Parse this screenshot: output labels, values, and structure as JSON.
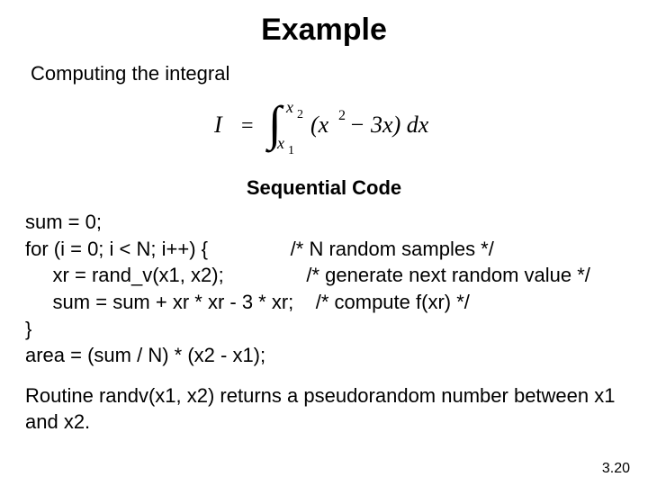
{
  "title": "Example",
  "subtitle": "Computing the integral",
  "integral": {
    "lhs": "I",
    "eq": "=",
    "lower": "x",
    "lower_sub": "1",
    "upper": "x",
    "upper_sub": "2",
    "inner_a": "(x",
    "inner_exp": "2",
    "inner_b": " − 3x) dx"
  },
  "section_heading": "Sequential Code",
  "code": "sum = 0;\nfor (i = 0; i < N; i++) {               /* N random samples */\n     xr = rand_v(x1, x2);               /* generate next random value */\n     sum = sum + xr * xr - 3 * xr;    /* compute f(xr) */\n}\narea = (sum / N) * (x2 - x1);",
  "routine_note": "Routine randv(x1, x2) returns a pseudorandom number between x1 and x2.",
  "page_number": "3.20"
}
